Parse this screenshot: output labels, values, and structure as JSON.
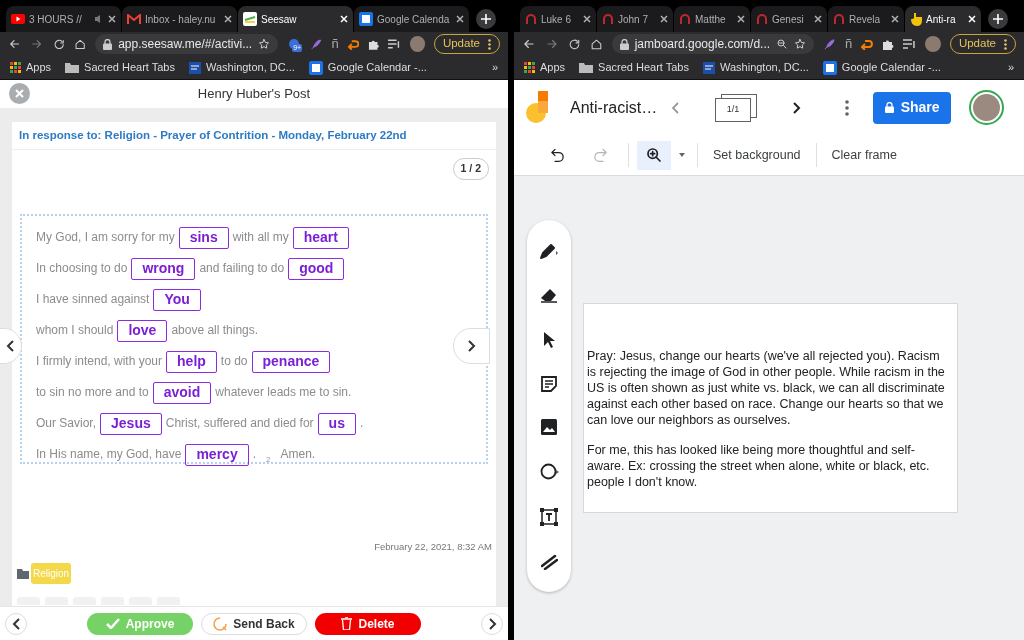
{
  "left_window": {
    "tabs": [
      {
        "title": "3 HOURS //",
        "kind": "video",
        "selected": false,
        "audio": true
      },
      {
        "title": "Inbox - haley.nu",
        "kind": "mail",
        "selected": false,
        "audio": false
      },
      {
        "title": "Seesaw",
        "kind": "seesaw",
        "selected": true,
        "audio": false
      },
      {
        "title": "Google Calenda",
        "kind": "calendar",
        "selected": false,
        "audio": false
      }
    ],
    "url": "app.seesaw.me/#/activi...",
    "extension_badge": "9+",
    "extension_glyph": "ñ",
    "update": "Update",
    "bookmarks": [
      {
        "label": "Apps",
        "kind": "apps"
      },
      {
        "label": "Sacred Heart Tabs",
        "kind": "folder"
      },
      {
        "label": "Washington, DC...",
        "kind": "news"
      },
      {
        "label": "Google Calendar -...",
        "kind": "calendar"
      }
    ],
    "bookmarks_more": "»"
  },
  "seesaw": {
    "title": "Henry Huber's Post",
    "prompt": "In response to: Religion - Prayer of Contrition - Monday, February 22nd",
    "page_indicator": "1 / 2",
    "lines": [
      {
        "parts": [
          {
            "kind": "text",
            "text": "My God, I am sorry for my"
          },
          {
            "kind": "answer",
            "text": "sins"
          },
          {
            "kind": "text",
            "text": "with all my"
          },
          {
            "kind": "answer",
            "text": "heart"
          }
        ]
      },
      {
        "parts": [
          {
            "kind": "text",
            "text": "In choosing to do"
          },
          {
            "kind": "answer",
            "text": "wrong"
          },
          {
            "kind": "text",
            "text": "and failing to do"
          },
          {
            "kind": "answer",
            "text": "good"
          }
        ]
      },
      {
        "parts": [
          {
            "kind": "text",
            "text": "I have sinned against"
          },
          {
            "kind": "answer",
            "text": "You"
          }
        ]
      },
      {
        "parts": [
          {
            "kind": "text",
            "text": "whom I should"
          },
          {
            "kind": "answer",
            "text": "love"
          },
          {
            "kind": "text",
            "text": "above all things."
          }
        ]
      },
      {
        "parts": [
          {
            "kind": "text",
            "text": "I firmly intend, with your"
          },
          {
            "kind": "answer",
            "text": "help"
          },
          {
            "kind": "text",
            "text": "to do"
          },
          {
            "kind": "answer",
            "text": "penance"
          }
        ]
      },
      {
        "parts": [
          {
            "kind": "text",
            "text": "to sin no more and to"
          },
          {
            "kind": "answer",
            "text": "avoid"
          },
          {
            "kind": "text",
            "text": "whatever leads me to sin."
          }
        ]
      },
      {
        "parts": [
          {
            "kind": "text",
            "text": "Our Savior,"
          },
          {
            "kind": "answer",
            "text": "Jesus"
          },
          {
            "kind": "text",
            "text": "Christ, suffered and died for"
          },
          {
            "kind": "answer",
            "text": "us"
          },
          {
            "kind": "text",
            "text": "."
          }
        ]
      },
      {
        "parts": [
          {
            "kind": "text",
            "text": "In His name, my God, have"
          },
          {
            "kind": "answer",
            "text": "mercy"
          },
          {
            "kind": "text",
            "text": "."
          },
          {
            "kind": "footnote",
            "text": "2"
          },
          {
            "kind": "text",
            "text": "Amen."
          }
        ]
      }
    ],
    "timestamp": "February 22, 2021, 8:32 AM",
    "tag": "Religion",
    "actions": [
      {
        "label": "Approve",
        "kind": "approve"
      },
      {
        "label": "Send Back",
        "kind": "send_back"
      },
      {
        "label": "Delete",
        "kind": "delete"
      }
    ]
  },
  "right_window": {
    "tabs": [
      {
        "title": "Luke 6",
        "kind": "bible",
        "selected": false,
        "audio": false
      },
      {
        "title": "John 7",
        "kind": "bible",
        "selected": false,
        "audio": false
      },
      {
        "title": "Matthe",
        "kind": "bible",
        "selected": false,
        "audio": false
      },
      {
        "title": "Genesi",
        "kind": "bible",
        "selected": false,
        "audio": false
      },
      {
        "title": "Revela",
        "kind": "bible",
        "selected": false,
        "audio": false
      },
      {
        "title": "Anti-ra",
        "kind": "hand",
        "selected": true,
        "audio": false
      }
    ],
    "url": "jamboard.google.com/d...",
    "extension_glyph": "ñ",
    "update": "Update",
    "bookmarks": [
      {
        "label": "Apps",
        "kind": "apps"
      },
      {
        "label": "Sacred Heart Tabs",
        "kind": "folder"
      },
      {
        "label": "Washington, DC...",
        "kind": "news"
      },
      {
        "label": "Google Calendar -...",
        "kind": "calendar"
      }
    ],
    "bookmarks_more": "»"
  },
  "jamboard": {
    "title": "Anti-racist…",
    "frame_counter": "1/1",
    "share": "Share",
    "redo_disabled": true,
    "zoom_selected": true,
    "actions": [
      "Set background",
      "Clear frame"
    ],
    "tools": [
      {
        "kind": "pen"
      },
      {
        "kind": "eraser"
      },
      {
        "kind": "pointer"
      },
      {
        "kind": "sticky"
      },
      {
        "kind": "image"
      },
      {
        "kind": "circle"
      },
      {
        "kind": "textbox"
      },
      {
        "kind": "laser"
      }
    ],
    "note": [
      "Pray: Jesus, change our hearts (we've all rejected you). Racism is rejecting the image of God in other people. While racism in the US is often shown as just white vs. black, we can all discriminate against each other based on race. Change our hearts so that we can love our neighbors as ourselves.",
      "For me, this has looked like being more thoughtful and self-aware. Ex: crossing the street when alone, white or black, etc. people I don't know."
    ]
  }
}
